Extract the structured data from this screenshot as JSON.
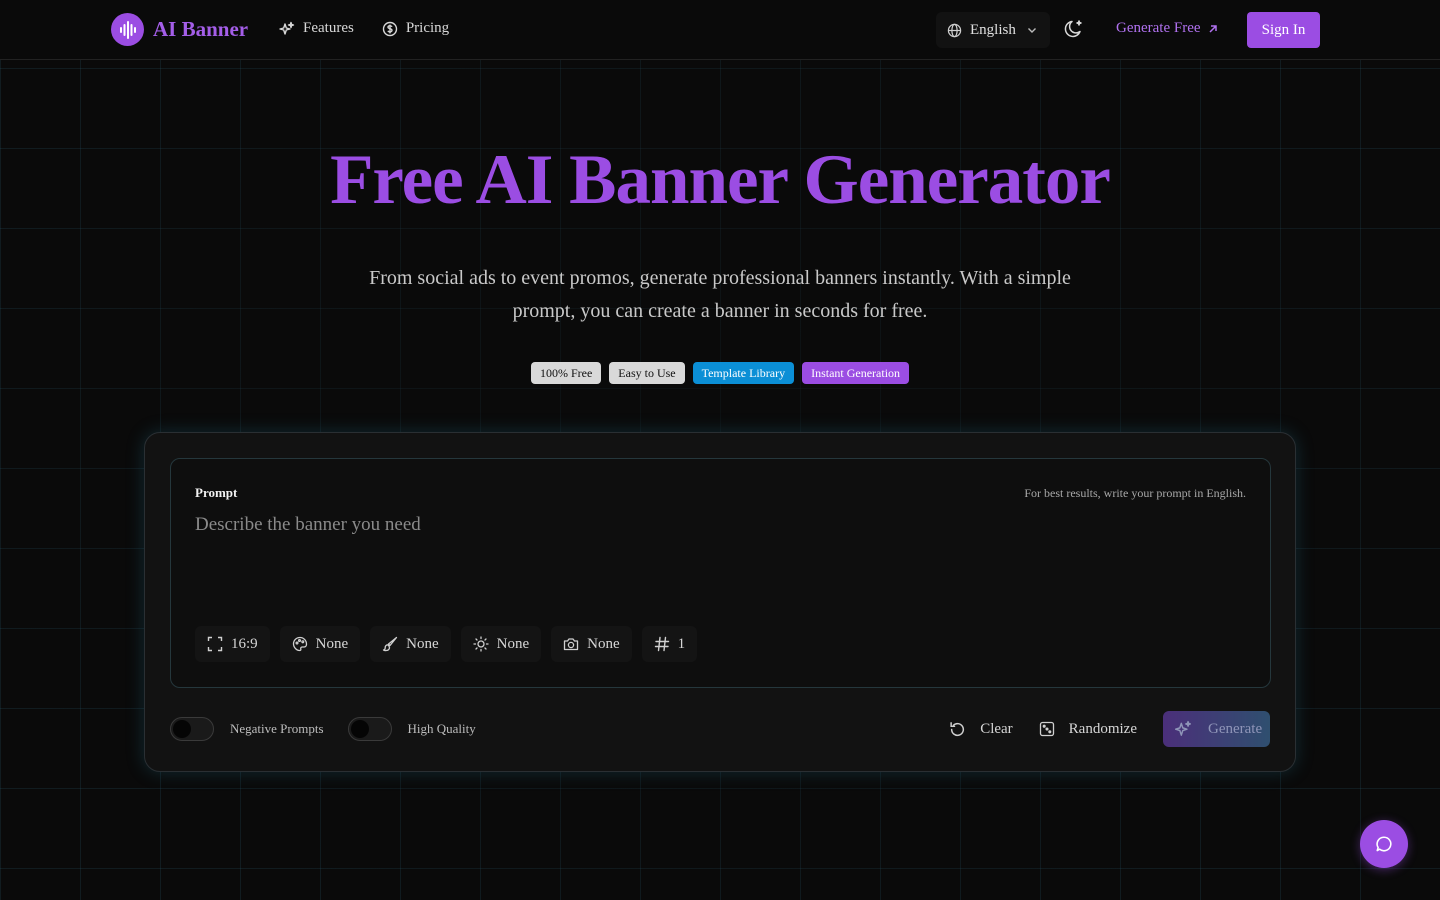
{
  "header": {
    "brand": "AI Banner",
    "nav": [
      {
        "label": "Features",
        "icon": "sparkles-icon"
      },
      {
        "label": "Pricing",
        "icon": "dollar-circle-icon"
      }
    ],
    "language": "English",
    "generate_free": "Generate Free",
    "sign_in": "Sign In"
  },
  "hero": {
    "title": "Free AI Banner Generator",
    "subtitle": "From social ads to event promos, generate professional banners instantly. With a simple prompt, you can create a banner in seconds for free.",
    "badges": [
      {
        "label": "100% Free",
        "color": "#d9d9d9"
      },
      {
        "label": "Easy to Use",
        "color": "#d9d9d9"
      },
      {
        "label": "Template Library",
        "color": "#0b8fd6"
      },
      {
        "label": "Instant Generation",
        "color": "#9b4de3"
      }
    ]
  },
  "generator": {
    "prompt_label": "Prompt",
    "prompt_hint": "For best results, write your prompt in English.",
    "prompt_placeholder": "Describe the banner you need",
    "prompt_value": "",
    "options": [
      {
        "icon": "aspect-ratio-icon",
        "value": "16:9"
      },
      {
        "icon": "palette-icon",
        "value": "None"
      },
      {
        "icon": "brush-icon",
        "value": "None"
      },
      {
        "icon": "sun-icon",
        "value": "None"
      },
      {
        "icon": "camera-icon",
        "value": "None"
      },
      {
        "icon": "hash-icon",
        "value": "1"
      }
    ],
    "toggles": [
      {
        "label": "Negative Prompts",
        "on": false
      },
      {
        "label": "High Quality",
        "on": false
      }
    ],
    "clear": "Clear",
    "randomize": "Randomize",
    "generate": "Generate"
  },
  "colors": {
    "accent": "#9b4de3",
    "background": "#0a0a0a",
    "badge_blue": "#0b8fd6"
  }
}
